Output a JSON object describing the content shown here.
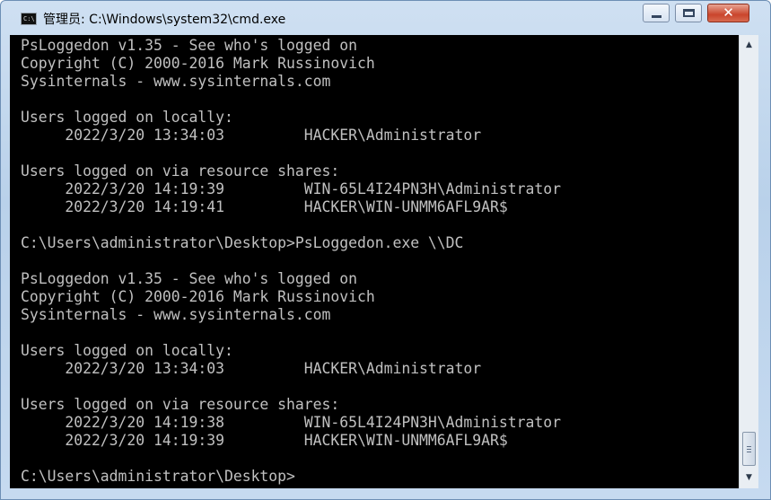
{
  "window": {
    "title": "管理员: C:\\Windows\\system32\\cmd.exe",
    "icon": "cmd-app-icon",
    "icon_text": "C:\\",
    "controls": {
      "minimize": "minimize-icon",
      "maximize": "maximize-icon",
      "close": "close-icon",
      "close_glyph": "✕"
    }
  },
  "console": {
    "background": "#000000",
    "foreground": "#c0c0c0",
    "lines": [
      "PsLoggedon v1.35 - See who's logged on",
      "Copyright (C) 2000-2016 Mark Russinovich",
      "Sysinternals - www.sysinternals.com",
      "",
      "Users logged on locally:",
      "     2022/3/20 13:34:03         HACKER\\Administrator",
      "",
      "Users logged on via resource shares:",
      "     2022/3/20 14:19:39         WIN-65L4I24PN3H\\Administrator",
      "     2022/3/20 14:19:41         HACKER\\WIN-UNMM6AFL9AR$",
      "",
      "C:\\Users\\administrator\\Desktop>PsLoggedon.exe \\\\DC",
      "",
      "PsLoggedon v1.35 - See who's logged on",
      "Copyright (C) 2000-2016 Mark Russinovich",
      "Sysinternals - www.sysinternals.com",
      "",
      "Users logged on locally:",
      "     2022/3/20 13:34:03         HACKER\\Administrator",
      "",
      "Users logged on via resource shares:",
      "     2022/3/20 14:19:38         WIN-65L4I24PN3H\\Administrator",
      "     2022/3/20 14:19:39         HACKER\\WIN-UNMM6AFL9AR$",
      "",
      "C:\\Users\\administrator\\Desktop>"
    ]
  },
  "scrollbar": {
    "up_glyph": "▲",
    "down_glyph": "▼",
    "position_fraction": 0.92
  }
}
